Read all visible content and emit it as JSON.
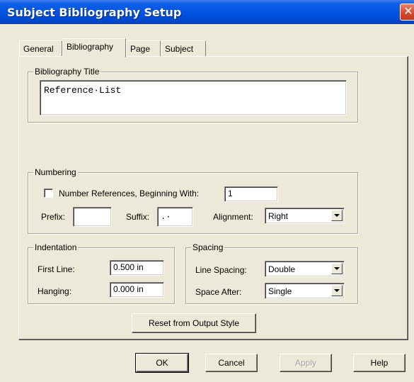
{
  "window": {
    "title": "Subject Bibliography Setup",
    "close_glyph": "✕"
  },
  "tabs": [
    {
      "label": "General"
    },
    {
      "label": "Bibliography"
    },
    {
      "label": "Page"
    },
    {
      "label": "Subject"
    }
  ],
  "active_tab": "Bibliography",
  "bibliography_title": {
    "group_label": "Bibliography Title",
    "value": "Reference·List"
  },
  "numbering": {
    "group_label": "Numbering",
    "number_refs_label": "Number References, Beginning With:",
    "number_refs_checked": false,
    "start_value": "1",
    "prefix_label": "Prefix:",
    "prefix_value": "",
    "suffix_label": "Suffix:",
    "suffix_value": ".·",
    "alignment_label": "Alignment:",
    "alignment_value": "Right"
  },
  "indentation": {
    "group_label": "Indentation",
    "first_line_label": "First Line:",
    "first_line_value": "0.500 in",
    "hanging_label": "Hanging:",
    "hanging_value": "0.000 in"
  },
  "spacing": {
    "group_label": "Spacing",
    "line_spacing_label": "Line Spacing:",
    "line_spacing_value": "Double",
    "space_after_label": "Space After:",
    "space_after_value": "Single"
  },
  "reset_button": {
    "label": "Reset from Output Style"
  },
  "footer": {
    "ok_label": "OK",
    "cancel_label": "Cancel",
    "apply_label": "Apply",
    "help_label": "Help",
    "apply_enabled": false
  },
  "colors": {
    "titlebar": "#0053e0",
    "dialog_face": "#ece9d8",
    "close_button": "#d3482f"
  }
}
